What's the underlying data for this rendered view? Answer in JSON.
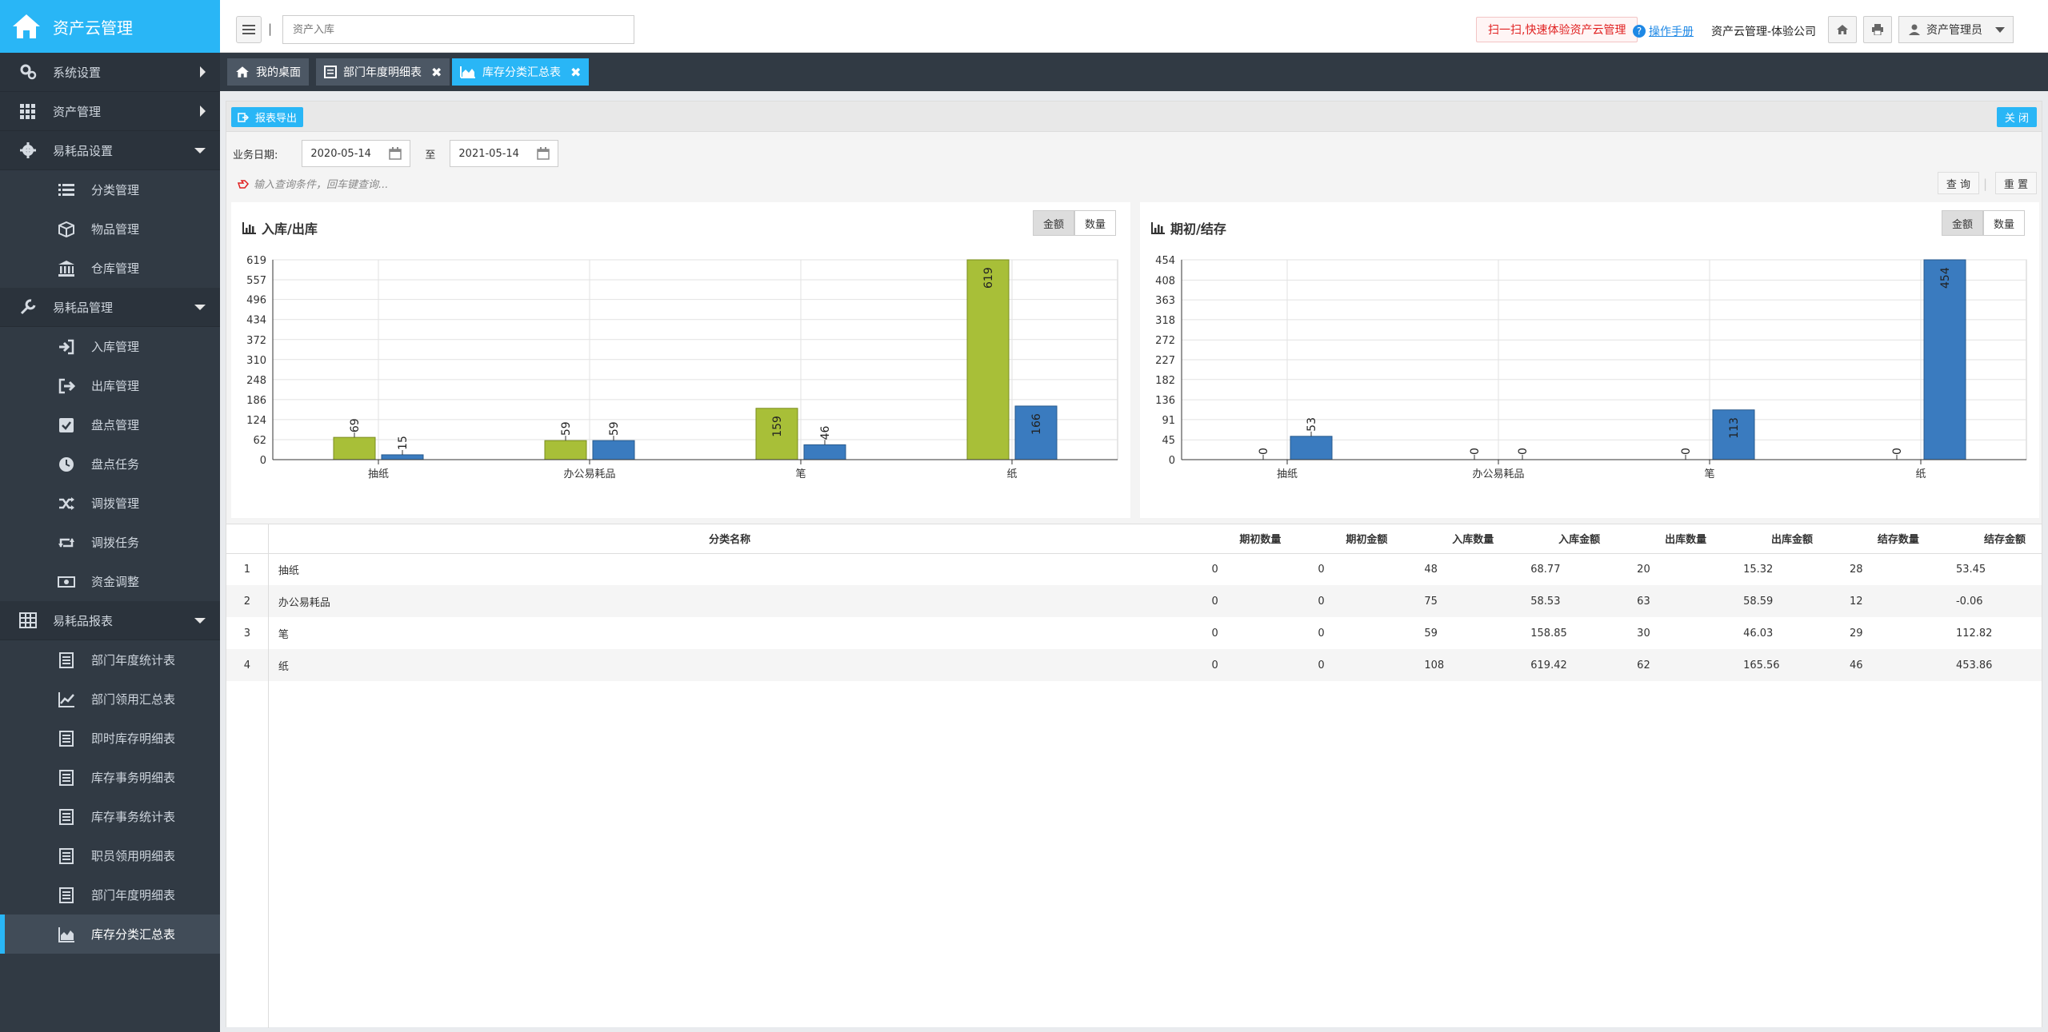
{
  "app": {
    "title": "资产云管理"
  },
  "sidebar": {
    "items": [
      {
        "label": "系统设置",
        "icon": "gears-icon",
        "level": "top",
        "arrow": "right"
      },
      {
        "label": "资产管理",
        "icon": "grid-icon",
        "level": "top",
        "arrow": "right"
      },
      {
        "label": "易耗品设置",
        "icon": "gear-icon",
        "level": "top",
        "arrow": "down"
      },
      {
        "label": "分类管理",
        "icon": "list-icon",
        "level": "sub"
      },
      {
        "label": "物品管理",
        "icon": "cube-icon",
        "level": "sub"
      },
      {
        "label": "仓库管理",
        "icon": "bank-icon",
        "level": "sub"
      },
      {
        "label": "易耗品管理",
        "icon": "wrench-icon",
        "level": "top",
        "arrow": "down"
      },
      {
        "label": "入库管理",
        "icon": "sign-in-icon",
        "level": "sub"
      },
      {
        "label": "出库管理",
        "icon": "sign-out-icon",
        "level": "sub"
      },
      {
        "label": "盘点管理",
        "icon": "check-square-icon",
        "level": "sub"
      },
      {
        "label": "盘点任务",
        "icon": "clock-icon",
        "level": "sub"
      },
      {
        "label": "调拨管理",
        "icon": "shuffle-icon",
        "level": "sub"
      },
      {
        "label": "调拨任务",
        "icon": "retweet-icon",
        "level": "sub"
      },
      {
        "label": "资金调整",
        "icon": "money-icon",
        "level": "sub"
      },
      {
        "label": "易耗品报表",
        "icon": "table-icon",
        "level": "top",
        "arrow": "down"
      },
      {
        "label": "部门年度统计表",
        "icon": "report-icon",
        "level": "sub"
      },
      {
        "label": "部门领用汇总表",
        "icon": "line-chart-icon",
        "level": "sub"
      },
      {
        "label": "即时库存明细表",
        "icon": "report-icon",
        "level": "sub"
      },
      {
        "label": "库存事务明细表",
        "icon": "report-icon",
        "level": "sub"
      },
      {
        "label": "库存事务统计表",
        "icon": "report-icon",
        "level": "sub"
      },
      {
        "label": "职员领用明细表",
        "icon": "report-icon",
        "level": "sub"
      },
      {
        "label": "部门年度明细表",
        "icon": "report-icon",
        "level": "sub"
      },
      {
        "label": "库存分类汇总表",
        "icon": "area-chart-icon",
        "level": "sub",
        "active": true
      }
    ]
  },
  "topbar": {
    "search_placeholder": "资产入库",
    "scan_label": "扫一扫,快速体验资产云管理",
    "manual_label": "操作手册",
    "company": "资产云管理-体验公司",
    "user": "资产管理员"
  },
  "tabs": [
    {
      "label": "我的桌面",
      "icon": "home-icon"
    },
    {
      "label": "部门年度明细表",
      "icon": "report-icon",
      "closable": true
    },
    {
      "label": "库存分类汇总表",
      "icon": "area-chart-icon",
      "closable": true,
      "active": true
    }
  ],
  "toolbar": {
    "export_label": "报表导出",
    "close_label": "关 闭"
  },
  "filter": {
    "date_label": "业务日期:",
    "start": "2020-05-14",
    "to": "至",
    "end": "2021-05-14",
    "hint": "输入查询条件，回车键查询...",
    "query_label": "查 询",
    "reset_label": "重 置"
  },
  "charts": {
    "amount_label": "金额",
    "quantity_label": "数量"
  },
  "chart_data": [
    {
      "type": "bar",
      "title": "入库/出库",
      "categories": [
        "抽纸",
        "办公易耗品",
        "笔",
        "纸"
      ],
      "ylim": [
        0,
        619
      ],
      "yticks": [
        0,
        62,
        124,
        186,
        248,
        310,
        372,
        434,
        496,
        557,
        619
      ],
      "series": [
        {
          "values": [
            69,
            59,
            159,
            619
          ],
          "color": "#a8bf38"
        },
        {
          "values": [
            15,
            59,
            46,
            166
          ],
          "color": "#3a7bbf"
        }
      ],
      "grid": true
    },
    {
      "type": "bar",
      "title": "期初/结存",
      "categories": [
        "抽纸",
        "办公易耗品",
        "笔",
        "纸"
      ],
      "ylim": [
        0,
        454
      ],
      "yticks": [
        0,
        45,
        91,
        136,
        182,
        227,
        272,
        318,
        363,
        408,
        454
      ],
      "series": [
        {
          "values": [
            0,
            0,
            0,
            0
          ],
          "color": "#a8bf38"
        },
        {
          "values": [
            53,
            0,
            113,
            454
          ],
          "color": "#3a7bbf"
        }
      ],
      "grid": true
    }
  ],
  "table": {
    "headers": [
      "分类名称",
      "期初数量",
      "期初金额",
      "入库数量",
      "入库金额",
      "出库数量",
      "出库金额",
      "结存数量",
      "结存金额"
    ],
    "rows": [
      [
        "1",
        "抽纸",
        "0",
        "0",
        "48",
        "68.77",
        "20",
        "15.32",
        "28",
        "53.45"
      ],
      [
        "2",
        "办公易耗品",
        "0",
        "0",
        "75",
        "58.53",
        "63",
        "58.59",
        "12",
        "-0.06"
      ],
      [
        "3",
        "笔",
        "0",
        "0",
        "59",
        "158.85",
        "30",
        "46.03",
        "29",
        "112.82"
      ],
      [
        "4",
        "纸",
        "0",
        "0",
        "108",
        "619.42",
        "62",
        "165.56",
        "46",
        "453.86"
      ]
    ]
  }
}
